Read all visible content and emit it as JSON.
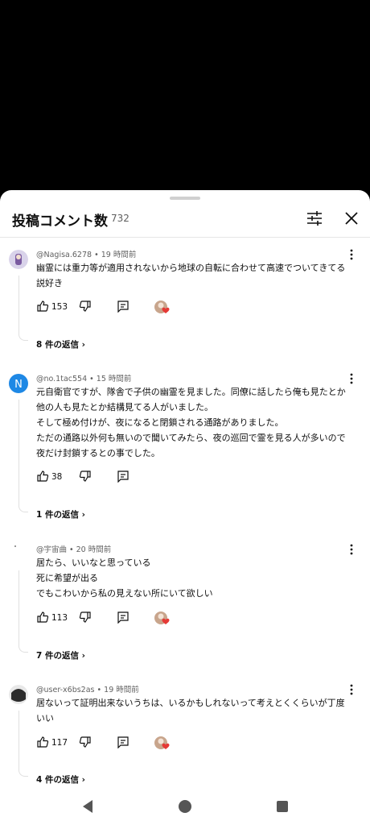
{
  "header": {
    "title": "投稿コメント数",
    "count": "732"
  },
  "comments": [
    {
      "meta": "@Nagisa.6278 • 19 時間前",
      "lines": [
        "幽霊には重力等が適用されないから地球の自転に合わせて高速でついてきてる",
        "説好き"
      ],
      "likes": "153",
      "replies": "8 件の返信",
      "creator_hearted": true,
      "avatar_color": "#c7bfe0"
    },
    {
      "meta": "@no.1tac554 • 15 時間前",
      "lines": [
        "元自衛官ですが、隊舎で子供の幽霊を見ました。同僚に話したら俺も見たとか",
        "他の人も見たとか結構見てる人がいました。",
        "そして極め付けが、夜になると閉鎖される通路がありました。",
        "ただの通路以外何も無いので聞いてみたら、夜の巡回で霊を見る人が多いので",
        "夜だけ封鎖するとの事でした。"
      ],
      "likes": "38",
      "replies": "1 件の返信",
      "creator_hearted": false,
      "avatar_letter": "N",
      "avatar_color": "#1e88e5"
    },
    {
      "meta": "@宇宙曲 • 20 時間前",
      "lines": [
        "居たら、いいなと思っている",
        "死に希望が出る",
        "でもこわいから私の見えない所にいて欲しい"
      ],
      "likes": "113",
      "replies": "7 件の返信",
      "creator_hearted": true,
      "avatar_color": "#ffffff"
    },
    {
      "meta": "@user-x6bs2as • 19 時間前",
      "lines": [
        "居ないって証明出来ないうちは、いるかもしれないって考えとくくらいが丁度",
        "いい"
      ],
      "likes": "117",
      "replies": "4 件の返信",
      "creator_hearted": true,
      "avatar_color": "#3a3a3a"
    }
  ]
}
